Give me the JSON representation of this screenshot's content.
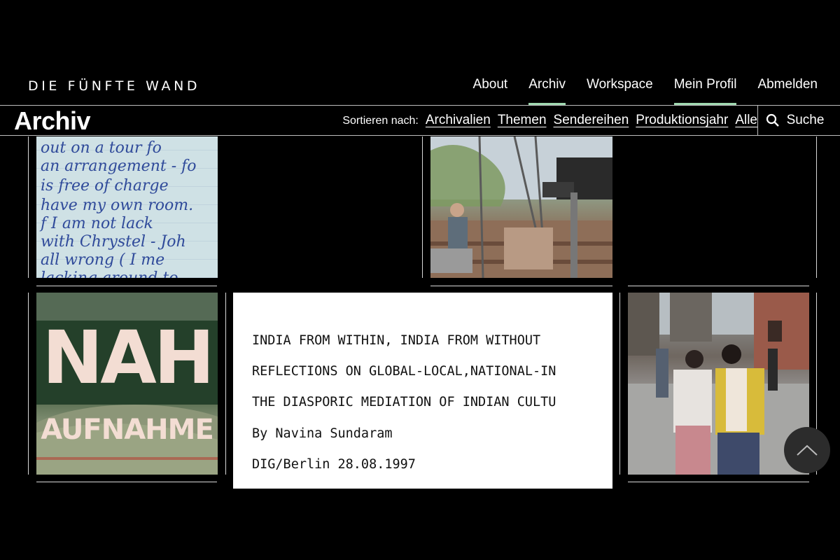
{
  "site_title": "DIE FÜNFTE WAND",
  "nav": [
    {
      "label": "About",
      "active": false
    },
    {
      "label": "Archiv",
      "active": true
    },
    {
      "label": "Workspace",
      "active": false
    },
    {
      "label": "Mein Profil",
      "active": true
    },
    {
      "label": "Abmelden",
      "active": false
    }
  ],
  "accent_color": "#9fd8b0",
  "archive_bar": {
    "title": "Archiv",
    "sort_label": "Sortieren nach:",
    "sort_options": [
      "Archivalien",
      "Themen",
      "Sendereihen",
      "Produktionsjahr",
      "Alle"
    ],
    "search_label": "Suche",
    "search_icon": "search-icon"
  },
  "tiles": {
    "letter": {
      "lines": [
        "out on a tour fo",
        "an arrangement - fo",
        "is free of charge",
        "have my own room.",
        "f I am not lack",
        "with Chrystel - Joh",
        "all wrong ( I me",
        "lacking around to"
      ]
    },
    "nah": {
      "line1": "NAH",
      "line2": "AUFNAHME"
    },
    "document": {
      "lines": [
        "INDIA FROM WITHIN, INDIA FROM WITHOUT",
        "REFLECTIONS ON GLOBAL-LOCAL,NATIONAL-IN",
        "THE DIASPORIC MEDIATION OF INDIAN CULTU",
        "By Navina Sundaram",
        "DIG/Berlin 28.08.1997"
      ]
    }
  },
  "scroll_top_icon": "chevron-up-icon"
}
